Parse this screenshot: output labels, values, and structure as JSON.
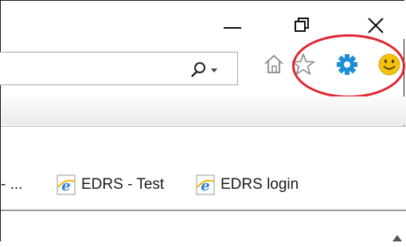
{
  "window": {
    "controls": [
      {
        "name": "minimize-button",
        "icon": "minimize-icon"
      },
      {
        "name": "restore-button",
        "icon": "restore-icon"
      },
      {
        "name": "close-button",
        "icon": "close-icon"
      }
    ]
  },
  "address_bar": {
    "value": "",
    "search_icon": "search-icon",
    "dropdown_icon": "chevron-down-icon"
  },
  "toolbar": {
    "icons": [
      "home-icon",
      "favorites-star-icon",
      "gear-icon",
      "smiley-feedback-icon"
    ],
    "highlight_color": "#e1252f",
    "gear_color": "#1e8fd6",
    "smiley_color": "#f4c20d"
  },
  "favorites": {
    "truncated_item": "- ...",
    "items": [
      {
        "label": "EDRS - Test",
        "icon": "ie-page-icon"
      },
      {
        "label": "EDRS login",
        "icon": "ie-page-icon"
      }
    ]
  }
}
